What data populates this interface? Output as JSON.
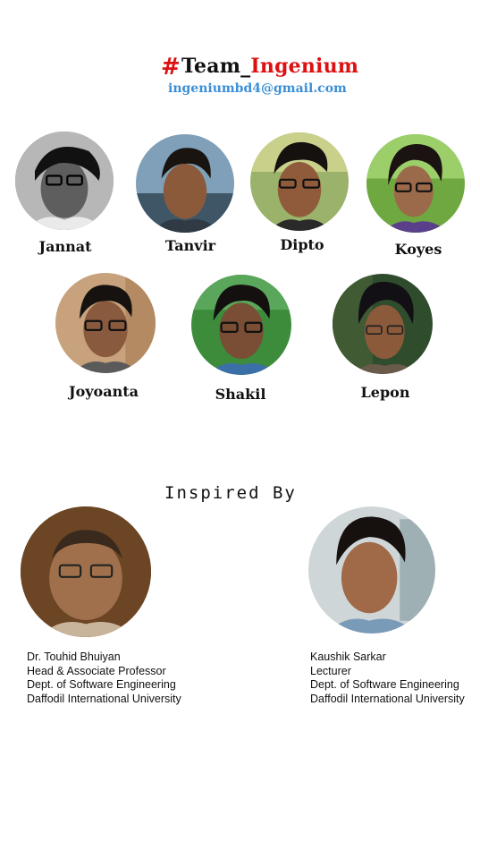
{
  "header": {
    "hash": "#",
    "team_prefix": "Team_",
    "team_suffix": "Ingenium",
    "email": "ingeniumbd4@gmail.com"
  },
  "team": {
    "members": [
      {
        "name": "Jannat"
      },
      {
        "name": "Tanvir"
      },
      {
        "name": "Dipto"
      },
      {
        "name": "Koyes"
      },
      {
        "name": "Joyoanta"
      },
      {
        "name": "Shakil"
      },
      {
        "name": "Lepon"
      }
    ]
  },
  "inspired": {
    "heading": "Inspired By",
    "mentors": [
      {
        "name": "Dr. Touhid Bhuiyan",
        "title": "Head & Associate Professor",
        "dept": "Dept. of  Software Engineering",
        "university": "Daffodil International University"
      },
      {
        "name": "Kaushik Sarkar",
        "title": "Lecturer",
        "dept": "Dept. of  Software Engineering",
        "university": "Daffodil International University"
      }
    ]
  },
  "colors": {
    "accent_red": "#dd1111",
    "email_blue": "#3b8fd6",
    "background": "#ffffff"
  }
}
